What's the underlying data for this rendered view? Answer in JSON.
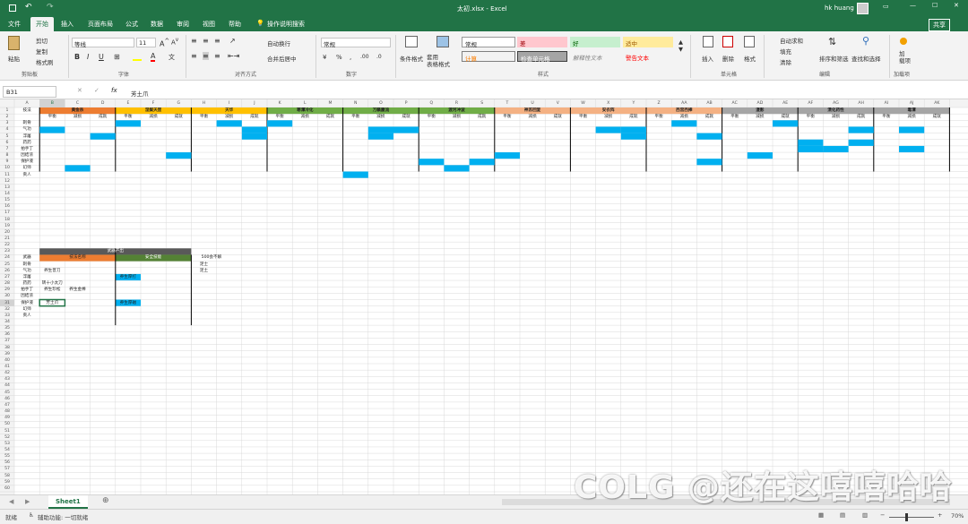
{
  "window": {
    "title": "太初.xlsx  -  Excel",
    "user": "hk huang",
    "share": "共享"
  },
  "tabs": [
    "文件",
    "开始",
    "插入",
    "页面布局",
    "公式",
    "数据",
    "审阅",
    "视图",
    "帮助"
  ],
  "tell_me": "操作说明搜索",
  "ribbon": {
    "paste": "粘贴",
    "cut": "剪切",
    "copy": "复制",
    "format_painter": "格式刷",
    "font_name": "等线",
    "font_size": "11",
    "wrap_text": "自动换行",
    "merge": "合并后居中",
    "number_format": "常规",
    "cond_format": "条件格式",
    "table_format": "套用\n表格格式",
    "styles": [
      {
        "label": "常规",
        "bg": "#ffffff",
        "fg": "#000000"
      },
      {
        "label": "差",
        "bg": "#ffc7ce",
        "fg": "#9c0006"
      },
      {
        "label": "好",
        "bg": "#c6efce",
        "fg": "#006100"
      },
      {
        "label": "适中",
        "bg": "#ffeb9c",
        "fg": "#9c5700"
      },
      {
        "label": "计算",
        "bg": "#f2f2f2",
        "fg": "#fa7d00"
      },
      {
        "label": "检查单元格",
        "bg": "#a5a5a5",
        "fg": "#ffffff"
      },
      {
        "label": "解释性文本",
        "bg": "#ffffff",
        "fg": "#7f7f7f"
      },
      {
        "label": "警告文本",
        "bg": "#ffffff",
        "fg": "#ff0000"
      }
    ],
    "insert": "插入",
    "delete": "删除",
    "format": "格式",
    "autosum": "自动求和",
    "fill": "填充",
    "clear": "清除",
    "sort_filter": "排序和筛选",
    "find_select": "查找和选择",
    "addin": "加\n载项",
    "groups": [
      "剪贴板",
      "字体",
      "对齐方式",
      "数字",
      "样式",
      "单元格",
      "编辑",
      "加载项"
    ]
  },
  "formula": {
    "name_box": "B31",
    "content": "芳土爪"
  },
  "columns": [
    "A",
    "B",
    "C",
    "D",
    "E",
    "F",
    "G",
    "H",
    "I",
    "J",
    "K",
    "L",
    "M",
    "N",
    "O",
    "P",
    "Q",
    "R",
    "S",
    "T",
    "U",
    "V",
    "W",
    "X",
    "Y",
    "Z",
    "AA",
    "AB",
    "AC",
    "AD",
    "AE",
    "AF",
    "AG",
    "AH",
    "AI",
    "AJ",
    "AK"
  ],
  "header_groups": [
    {
      "label": "黄金杀",
      "color": "#ed7d31",
      "span": 3
    },
    {
      "label": "涅槃天罡",
      "color": "#ffc000",
      "span": 3
    },
    {
      "label": "天华",
      "color": "#ffc000",
      "span": 3
    },
    {
      "label": "寒潭冷化",
      "color": "#70ad47",
      "span": 3
    },
    {
      "label": "万籁蜃流",
      "color": "#70ad47",
      "span": 3
    },
    {
      "label": "渡河冲波",
      "color": "#70ad47",
      "span": 3
    },
    {
      "label": "神苏回复",
      "color": "#f4b183",
      "span": 3
    },
    {
      "label": "安农阵",
      "color": "#f4b183",
      "span": 3
    },
    {
      "label": "西宫西捧",
      "color": "#f4b183",
      "span": 3
    },
    {
      "label": "漫影",
      "color": "#a5a5a5",
      "span": 3
    },
    {
      "label": "溃化药性",
      "color": "#a5a5a5",
      "span": 3
    },
    {
      "label": "毒潭",
      "color": "#a5a5a5",
      "span": 3
    }
  ],
  "sub_headers": [
    "平衡",
    "减损",
    "成就"
  ],
  "row1_a": "技法",
  "row_labels": [
    "刺骨",
    "气功",
    "浮屠",
    "药药",
    "拍手丁",
    "因结浓",
    "保护液",
    "幻师",
    "贡人"
  ],
  "lower": {
    "title": "武器产出",
    "hdr1": "技法名称",
    "hdr2": "安全技能",
    "note1": "500会不解",
    "note2": "足士",
    "note3": "足土",
    "rows": [
      "武器",
      "刺骨",
      "气功",
      "浮屠",
      "药药",
      "拍手丁",
      "因结浓",
      "保护液",
      "幻师",
      "贡人"
    ],
    "c26": "养生普刀",
    "c28": "转十小太刀",
    "c29a": "养生珍松",
    "c29b": "养生金棒",
    "selected": "芳土爪",
    "blue1": "养生厚打",
    "blue2": "养生厚磁"
  },
  "sheet_tab": "Sheet1",
  "status": {
    "mode": "就绪",
    "accessibility": "辅助功能: 一切就绪",
    "zoom": "70%"
  },
  "watermark": "COLG @还在这嘻嘻哈哈"
}
